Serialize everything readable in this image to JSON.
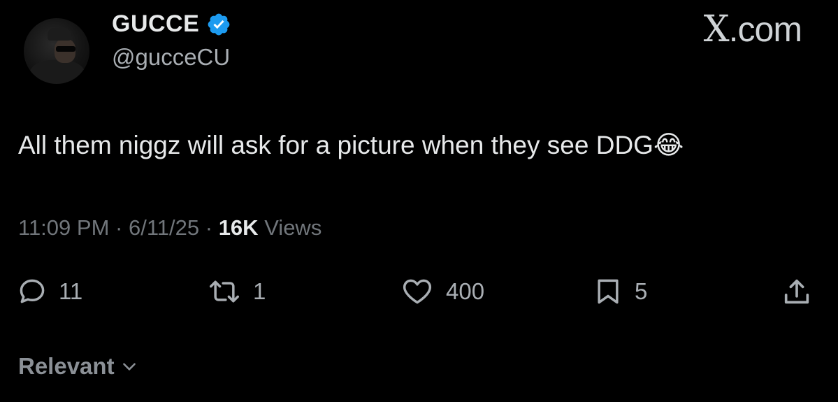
{
  "author": {
    "display_name": "GUCCE",
    "handle": "@gucceCU",
    "verified": true
  },
  "brand": {
    "x_glyph": "X",
    "domain": ".com"
  },
  "tweet": {
    "text": "All them niggz will ask for a picture when they see DDG",
    "emoji": "😂",
    "time": "11:09 PM",
    "separator": "·",
    "date": "6/11/25",
    "views_count": "16K",
    "views_label": "Views"
  },
  "actions": {
    "replies": "11",
    "reposts": "1",
    "likes": "400",
    "bookmarks": "5"
  },
  "sort": {
    "label": "Relevant"
  },
  "colors": {
    "background": "#000000",
    "primary_text": "#e7e9ea",
    "secondary_text": "#71767b",
    "verified_blue": "#1d9bf0"
  },
  "icons": [
    "verified-badge-icon",
    "reply-icon",
    "repost-icon",
    "like-icon",
    "bookmark-icon",
    "share-icon",
    "chevron-down-icon"
  ]
}
